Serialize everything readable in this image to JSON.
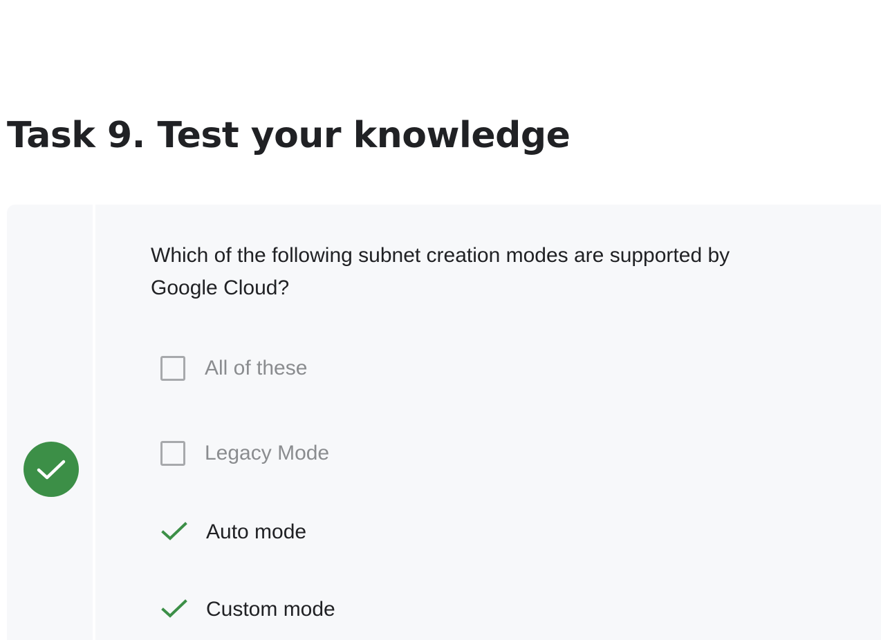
{
  "task": {
    "heading": "Task 9. Test your knowledge"
  },
  "quiz": {
    "status": "correct",
    "status_icon": "check-icon",
    "accent_color": "#3c8f47",
    "question": "Which of the following subnet creation modes are supported by Google Cloud?",
    "options": [
      {
        "label": "All of these",
        "selected": false
      },
      {
        "label": "Legacy Mode",
        "selected": false
      },
      {
        "label": "Auto mode",
        "selected": true
      },
      {
        "label": "Custom mode",
        "selected": true
      }
    ]
  }
}
